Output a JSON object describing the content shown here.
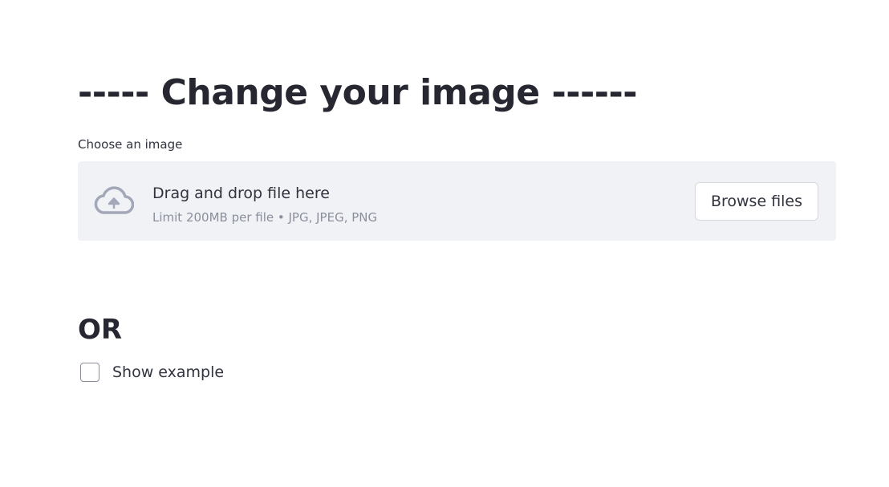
{
  "title": "----- Change your image ------",
  "uploader": {
    "label": "Choose an image",
    "icon": "cloud-upload-icon",
    "drop_text": "Drag and drop file here",
    "limit_text": "Limit 200MB per file • JPG, JPEG, PNG",
    "browse_label": "Browse files"
  },
  "or_heading": "OR",
  "show_example": {
    "label": "Show example",
    "checked": false
  },
  "colors": {
    "text": "#262730",
    "dropzone_bg": "#f0f2f6",
    "muted": "#8b8f9c"
  }
}
